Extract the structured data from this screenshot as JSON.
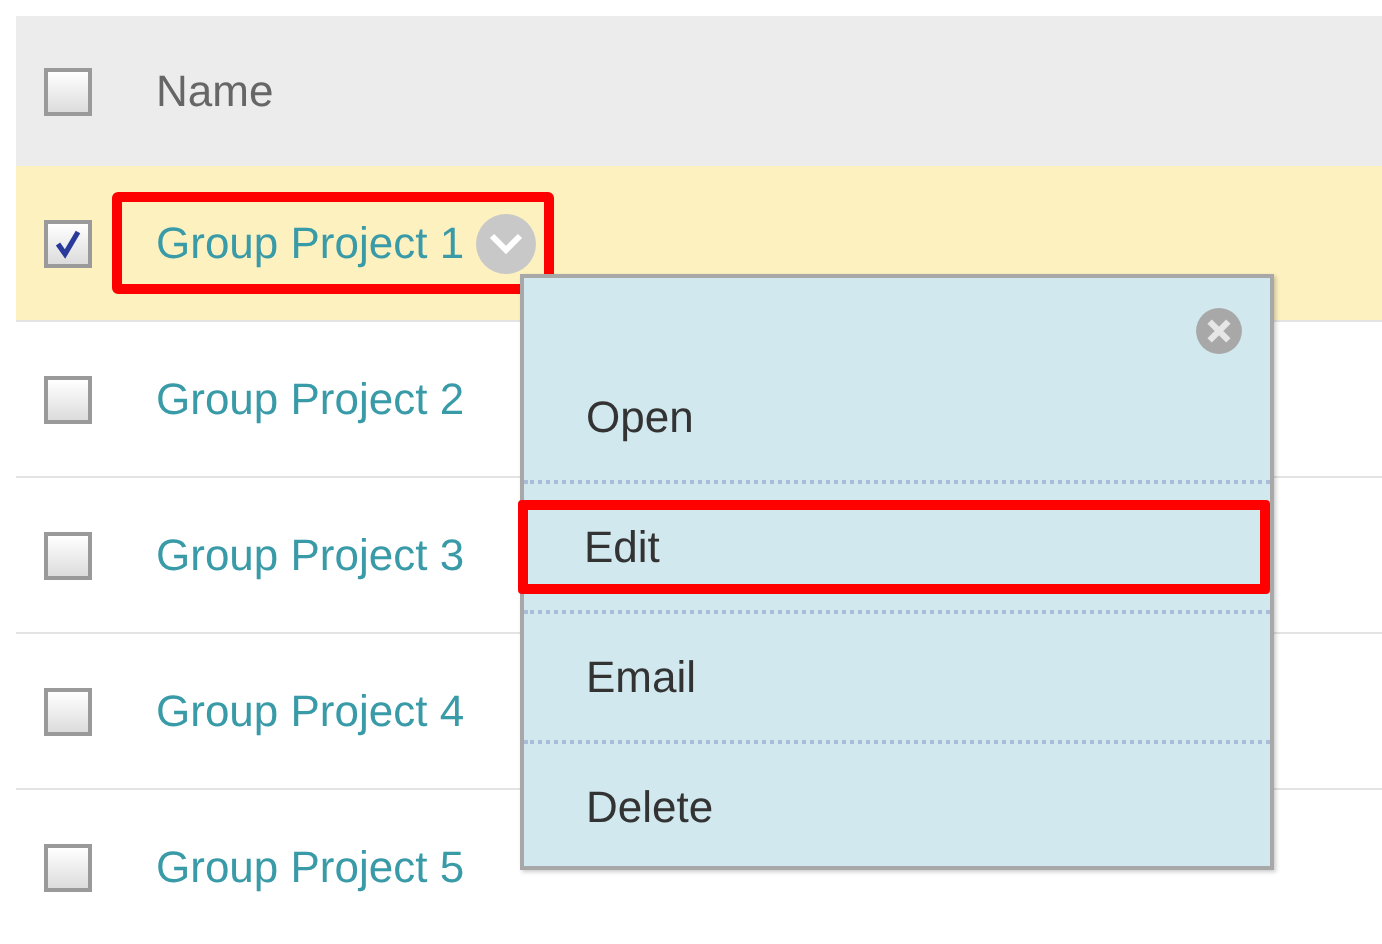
{
  "table": {
    "header": {
      "checked": false,
      "label": "Name"
    },
    "rows": [
      {
        "name": "Group Project 1",
        "checked": true,
        "selected": true,
        "highlighted": true,
        "menu_button": true
      },
      {
        "name": "Group Project 2",
        "checked": false,
        "selected": false,
        "highlighted": false,
        "menu_button": false
      },
      {
        "name": "Group Project 3",
        "checked": false,
        "selected": false,
        "highlighted": false,
        "menu_button": false
      },
      {
        "name": "Group Project 4",
        "checked": false,
        "selected": false,
        "highlighted": false,
        "menu_button": false
      },
      {
        "name": "Group Project 5",
        "checked": false,
        "selected": false,
        "highlighted": false,
        "menu_button": false
      }
    ]
  },
  "menu": {
    "items": [
      {
        "label": "Open",
        "highlighted": false
      },
      {
        "label": "Edit",
        "highlighted": true
      },
      {
        "label": "Email",
        "highlighted": false
      },
      {
        "label": "Delete",
        "highlighted": false
      }
    ]
  }
}
